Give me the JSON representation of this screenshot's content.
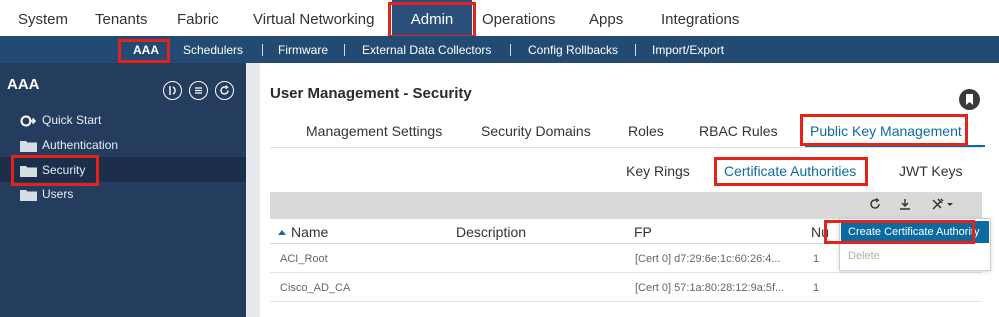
{
  "topnav": {
    "tabs": [
      {
        "label": "System"
      },
      {
        "label": "Tenants"
      },
      {
        "label": "Fabric"
      },
      {
        "label": "Virtual Networking"
      },
      {
        "label": "Admin",
        "active": true
      },
      {
        "label": "Operations"
      },
      {
        "label": "Apps"
      },
      {
        "label": "Integrations"
      }
    ]
  },
  "subnav": {
    "items": [
      {
        "label": "AAA",
        "active": true
      },
      {
        "label": "Schedulers"
      },
      {
        "label": "Firmware"
      },
      {
        "label": "External Data Collectors"
      },
      {
        "label": "Config Rollbacks"
      },
      {
        "label": "Import/Export"
      }
    ]
  },
  "sidebar": {
    "title": "AAA",
    "items": [
      {
        "label": "Quick Start",
        "icon": "quick-start-icon"
      },
      {
        "label": "Authentication",
        "icon": "folder-icon"
      },
      {
        "label": "Security",
        "icon": "folder-icon",
        "selected": true
      },
      {
        "label": "Users",
        "icon": "folder-icon"
      }
    ]
  },
  "main": {
    "title": "User Management - Security",
    "tabs": [
      {
        "label": "Management Settings"
      },
      {
        "label": "Security Domains"
      },
      {
        "label": "Roles"
      },
      {
        "label": "RBAC Rules"
      },
      {
        "label": "Public Key Management",
        "active": true
      }
    ],
    "subtabs": [
      {
        "label": "Key Rings"
      },
      {
        "label": "Certificate Authorities",
        "active": true
      },
      {
        "label": "JWT Keys"
      }
    ],
    "table": {
      "columns": [
        "Name",
        "Description",
        "FP",
        "Nu"
      ],
      "rows": [
        {
          "name": "ACI_Root",
          "description": "",
          "fp": "[Cert 0] d7:29:6e:1c:60:26:4...",
          "num": "1"
        },
        {
          "name": "Cisco_AD_CA",
          "description": "",
          "fp": "[Cert 0] 57:1a:80:28:12:9a:5f...",
          "num": "1"
        }
      ]
    },
    "actions_menu": {
      "create_label": "Create Certificate Authority",
      "delete_label": "Delete"
    }
  },
  "colors": {
    "accent": "#0b6aa2",
    "nav_dark": "#234a73",
    "sidebar": "#243c5e",
    "highlight": "#e2231a"
  }
}
